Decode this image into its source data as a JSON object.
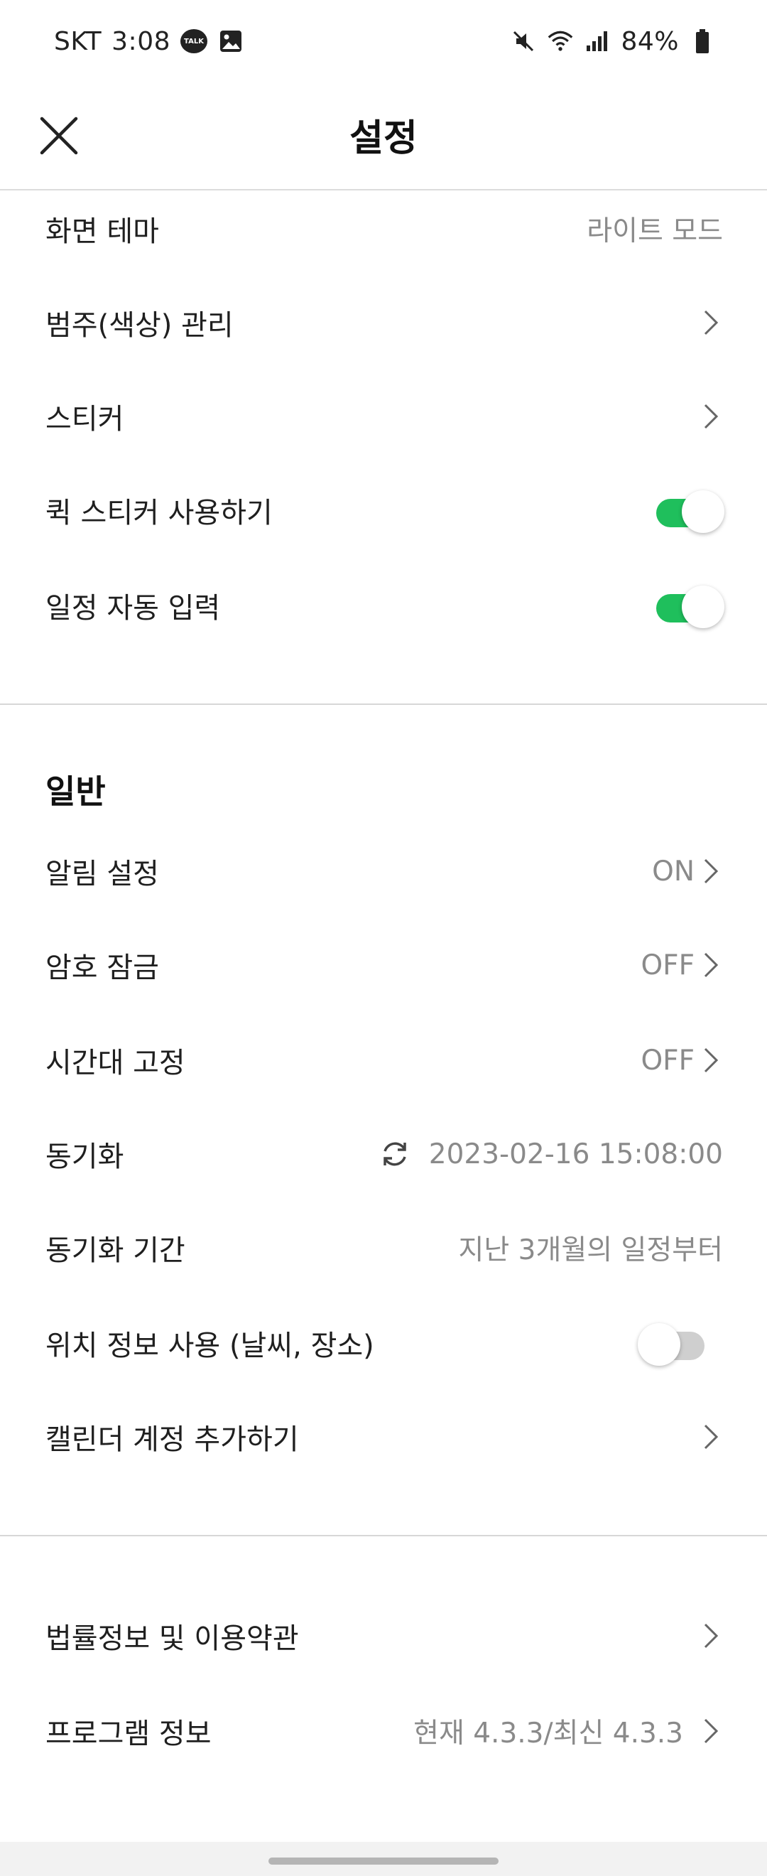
{
  "status_bar": {
    "carrier": "SKT",
    "time": "3:08",
    "talk_badge": "TALK",
    "battery": "84%"
  },
  "header": {
    "title": "설정"
  },
  "display_section": {
    "theme": {
      "label": "화면 테마",
      "value": "라이트 모드"
    },
    "category_colors": {
      "label": "범주(색상) 관리"
    },
    "stickers": {
      "label": "스티커"
    },
    "quick_sticker": {
      "label": "퀵 스티커 사용하기",
      "enabled": true
    },
    "auto_schedule": {
      "label": "일정 자동 입력",
      "enabled": true
    }
  },
  "general_section": {
    "title": "일반",
    "notifications": {
      "label": "알림 설정",
      "value": "ON"
    },
    "passcode_lock": {
      "label": "암호 잠금",
      "value": "OFF"
    },
    "fixed_timezone": {
      "label": "시간대 고정",
      "value": "OFF"
    },
    "sync": {
      "label": "동기화",
      "value": "2023-02-16 15:08:00"
    },
    "sync_period": {
      "label": "동기화 기간",
      "value": "지난 3개월의 일정부터"
    },
    "location": {
      "label": "위치 정보 사용 (날씨, 장소)",
      "enabled": false
    },
    "add_calendar_account": {
      "label": "캘린더 계정 추가하기"
    }
  },
  "info_section": {
    "legal": {
      "label": "법률정보 및 이용약관"
    },
    "program_info": {
      "label": "프로그램 정보",
      "value": "현재 4.3.3/최신 4.3.3"
    }
  },
  "colors": {
    "toggle_on": "#1fbf5c",
    "toggle_off": "#cfcfcf",
    "secondary_text": "#8a8a8a"
  }
}
